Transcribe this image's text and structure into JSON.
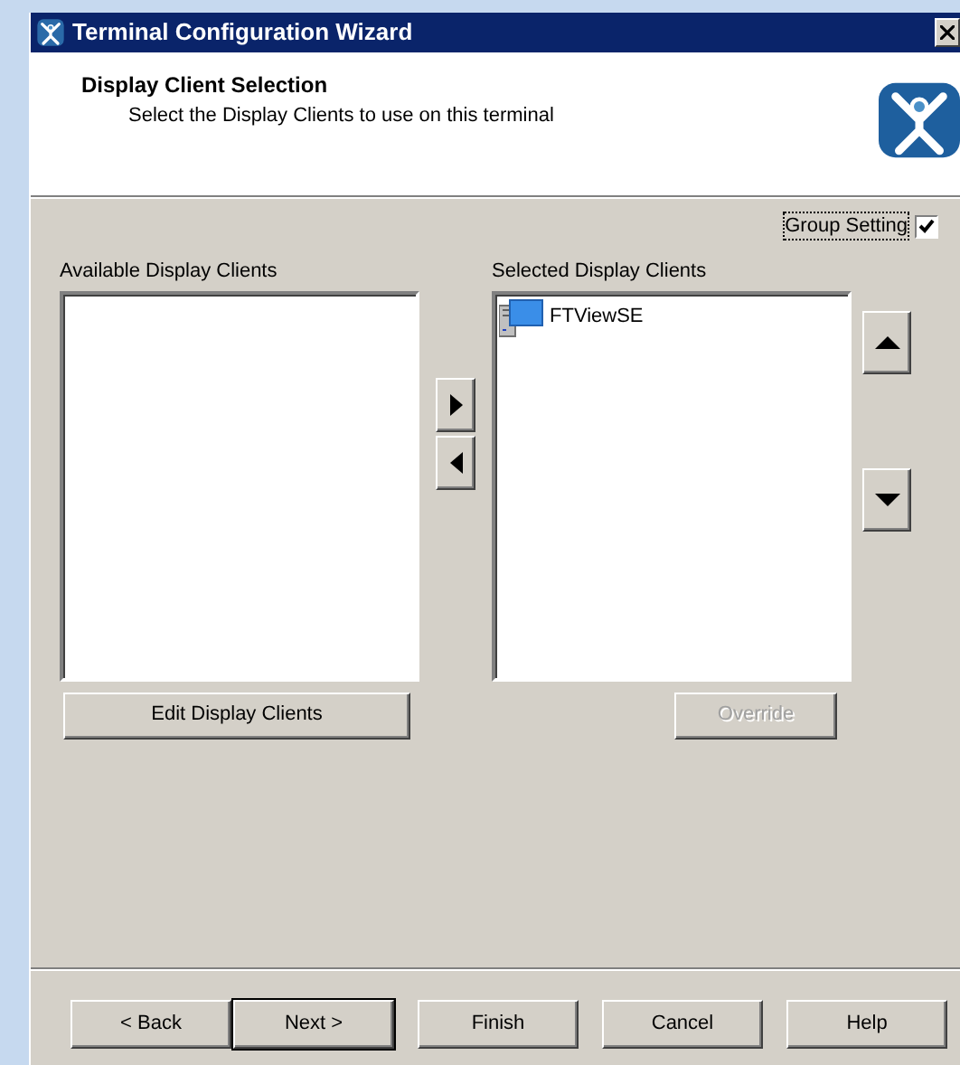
{
  "window": {
    "title": "Terminal Configuration Wizard"
  },
  "header": {
    "title": "Display Client Selection",
    "subtitle": "Select the Display Clients to use on this terminal"
  },
  "group_setting": {
    "label": "Group Setting",
    "checked": true,
    "focused": true
  },
  "available": {
    "label": "Available Display Clients"
  },
  "selected": {
    "label": "Selected Display Clients",
    "items": [
      {
        "label": "FTViewSE"
      }
    ]
  },
  "edit_button": {
    "label": "Edit Display Clients",
    "disabled": false
  },
  "override_button": {
    "label": "Override",
    "disabled": true
  },
  "buttons": [
    {
      "label": "< Back",
      "default": false
    },
    {
      "label": "Next >",
      "default": true
    },
    {
      "label": "Finish",
      "default": false
    },
    {
      "label": "Cancel",
      "default": false
    },
    {
      "label": "Help",
      "default": false
    }
  ]
}
